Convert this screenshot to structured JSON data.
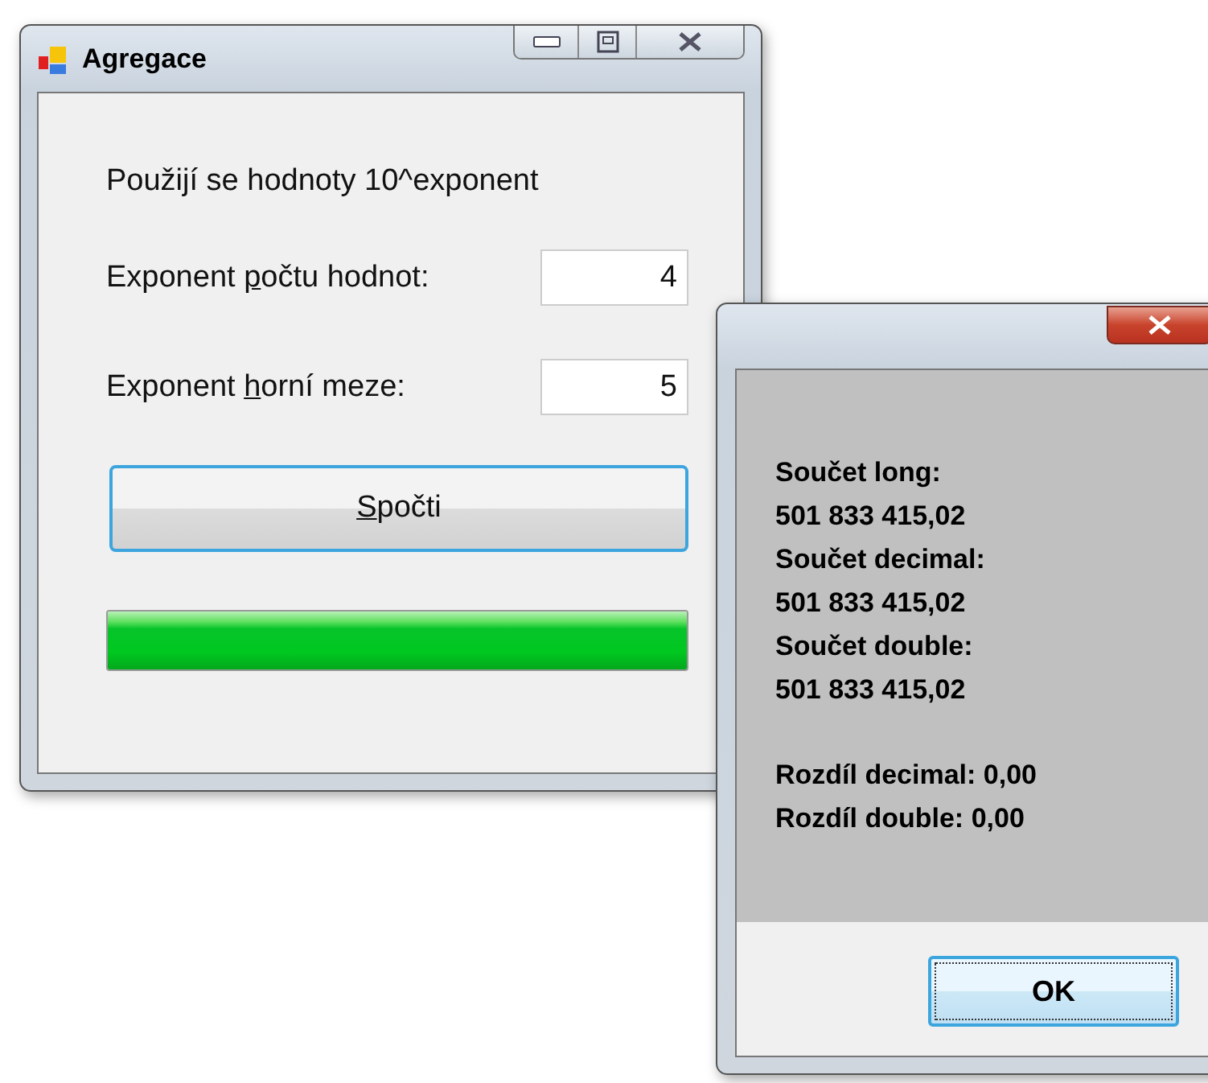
{
  "main_window": {
    "title": "Agregace",
    "intro": "Použijí se hodnoty 10^exponent",
    "fields": [
      {
        "label": {
          "before": "Exponent ",
          "key": "p",
          "after": "očtu hodnot:"
        },
        "value": "4"
      },
      {
        "label": {
          "before": "Exponent ",
          "key": "h",
          "after": "orní meze:"
        },
        "value": "5"
      }
    ],
    "button": {
      "key": "S",
      "after": "počti"
    },
    "progress": {
      "level": 1
    }
  },
  "message_box": {
    "paragraphs": [
      [
        "Součet long:",
        "501 833 415,02",
        "Součet decimal:",
        "501 833 415,02",
        "Součet double:",
        "501 833 415,02"
      ],
      [
        "Rozdíl decimal: 0,00",
        "Rozdíl double: 0,00"
      ]
    ],
    "button": "OK"
  }
}
